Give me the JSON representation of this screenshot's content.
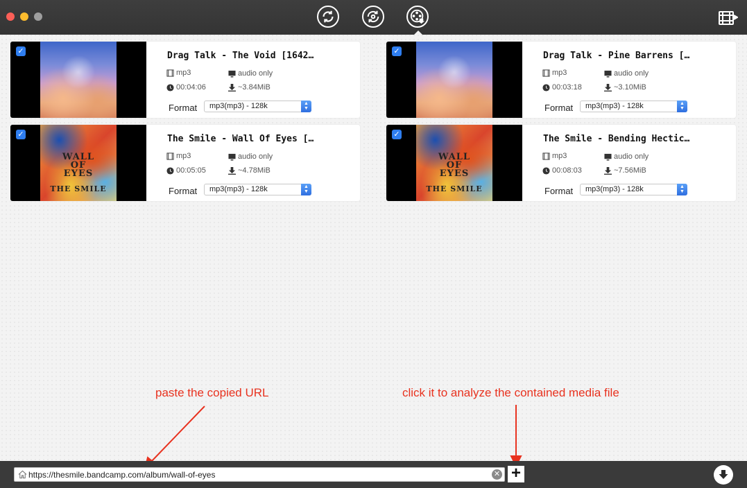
{
  "toolbar": {
    "modes": [
      {
        "icon": "refresh-icon",
        "name": "convert"
      },
      {
        "icon": "convert-icon",
        "name": "convert-alt"
      },
      {
        "icon": "film-reel-download-icon",
        "name": "download",
        "active": true
      }
    ],
    "library_icon": "film-library-icon"
  },
  "cards": [
    {
      "title": "Drag Talk - The Void [1642…",
      "format": "mp3",
      "type": "audio only",
      "duration": "00:04:06",
      "size": "~3.84MiB",
      "format_label": "Format",
      "select_value": "mp3(mp3) - 128k",
      "checked": true,
      "art": "void"
    },
    {
      "title": "Drag Talk - Pine Barrens […",
      "format": "mp3",
      "type": "audio only",
      "duration": "00:03:18",
      "size": "~3.10MiB",
      "format_label": "Format",
      "select_value": "mp3(mp3) - 128k",
      "checked": true,
      "art": "void"
    },
    {
      "title": "The Smile - Wall Of Eyes […",
      "format": "mp3",
      "type": "audio only",
      "duration": "00:05:05",
      "size": "~4.78MiB",
      "format_label": "Format",
      "select_value": "mp3(mp3) - 128k",
      "checked": true,
      "art": "eyes"
    },
    {
      "title": "The Smile - Bending Hectic…",
      "format": "mp3",
      "type": "audio only",
      "duration": "00:08:03",
      "size": "~7.56MiB",
      "format_label": "Format",
      "select_value": "mp3(mp3) - 128k",
      "checked": true,
      "art": "eyes"
    }
  ],
  "album_art_text": {
    "line1": "WALL",
    "line2": "OF",
    "line3": "EYES",
    "line4": "THE SMILE"
  },
  "annotations": {
    "paste": "paste the copied URL",
    "analyze": "click it to analyze the contained media file",
    "color": "#e8321f"
  },
  "bottom": {
    "url_value": "https://thesmile.bandcamp.com/album/wall-of-eyes",
    "add_label": "+",
    "clear_label": "✕"
  }
}
